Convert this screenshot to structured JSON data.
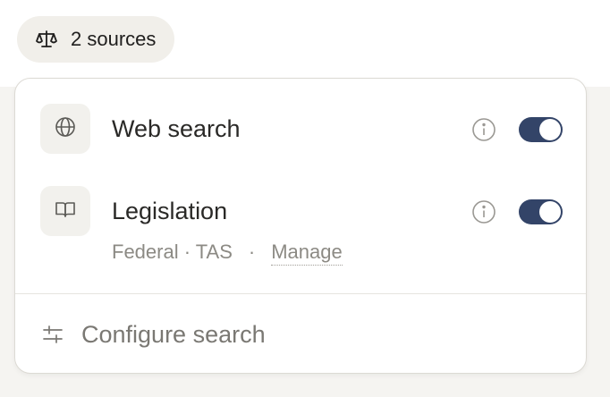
{
  "sources_button": {
    "icon": "scale-icon",
    "label": "2 sources"
  },
  "sources": [
    {
      "icon": "globe-icon",
      "title": "Web search",
      "enabled": true
    },
    {
      "icon": "book-icon",
      "title": "Legislation",
      "enabled": true,
      "meta": {
        "jurisdiction": "Federal · TAS",
        "separator": "·",
        "manage_label": "Manage"
      }
    }
  ],
  "footer": {
    "icon": "sliders-icon",
    "label": "Configure search"
  },
  "colors": {
    "toggle_on": "#334468",
    "pill_bg": "#f1efea",
    "tile_bg": "#f2f1ed"
  }
}
